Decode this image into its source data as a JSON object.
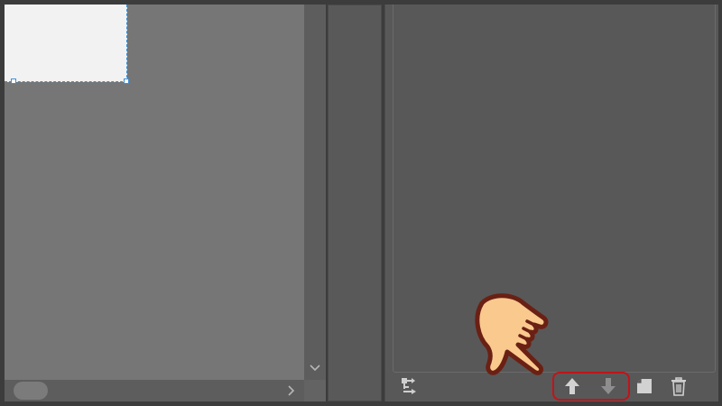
{
  "canvas": {
    "background": "#767676",
    "selection_fill": "#f2f2f2",
    "selection_border": "#3a8fd8"
  },
  "scrollbars": {
    "vertical_down_icon": "chevron-down-icon",
    "horizontal_right_icon": "chevron-right-icon"
  },
  "panel": {
    "toolbar": {
      "buttons": [
        {
          "name": "convert-button",
          "icon": "convert-icon"
        },
        {
          "name": "move-up-button",
          "icon": "arrow-up-icon"
        },
        {
          "name": "move-down-button",
          "icon": "arrow-down-icon"
        },
        {
          "name": "new-layer-button",
          "icon": "new-page-icon"
        },
        {
          "name": "delete-button",
          "icon": "trash-icon"
        }
      ]
    },
    "highlight_color": "#c0141a"
  },
  "pointer": {
    "icon": "pointing-hand-icon",
    "skin": "#f9c98e",
    "outline": "#6b2014"
  }
}
